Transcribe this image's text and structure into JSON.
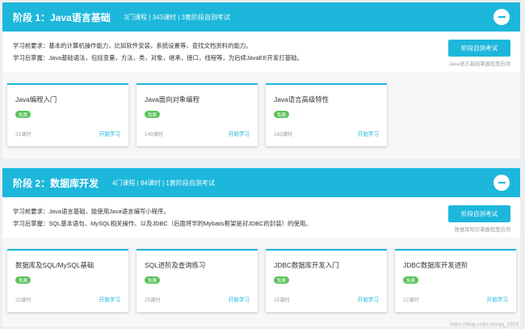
{
  "stages": [
    {
      "title": "阶段 1：Java语言基础",
      "meta": "3门课程 | 343课时 | 3套阶段自测考试",
      "requirement_before": "学习前要求：基本的计算机操作能力，比如软件安装，系统设置等，查找文档资料的能力。",
      "requirement_after": "学习后掌握：Java基础语法，包括变量，方法，类，对象，继承，接口，线程等，为后续JavaEE开发打基础。",
      "test_button": "阶段自测考试",
      "test_tip": "Java语言基础掌握程度自测",
      "courses": [
        {
          "name": "Java编程入门",
          "badge": "免费",
          "hours": "31课时",
          "action": "开始学习"
        },
        {
          "name": "Java面向对象编程",
          "badge": "免费",
          "hours": "149课时",
          "action": "开始学习"
        },
        {
          "name": "Java语言高级特性",
          "badge": "免费",
          "hours": "163课时",
          "action": "开始学习"
        }
      ]
    },
    {
      "title": "阶段 2：数据库开发",
      "meta": "4门课程 | 84课时 | 1套阶段自测考试",
      "requirement_before": "学习前要求：Java语言基础，能使用Java语言编写小程序。",
      "requirement_after": "学习后掌握：SQL基本语句、MySQL相关操作、以及JDBC（后面将学的Mybatis框架是对JDBC的封装）的使用。",
      "test_button": "阶段自测考试",
      "test_tip": "数据库知识掌握程度自测",
      "courses": [
        {
          "name": "数据库及SQL/MySQL基础",
          "badge": "免费",
          "hours": "22课时",
          "action": "开始学习"
        },
        {
          "name": "SQL进阶及查询练习",
          "badge": "免费",
          "hours": "25课时",
          "action": "开始学习"
        },
        {
          "name": "JDBC数据库开发入门",
          "badge": "免费",
          "hours": "15课时",
          "action": "开始学习"
        },
        {
          "name": "JDBC数据库开发进阶",
          "badge": "免费",
          "hours": "22课时",
          "action": "开始学习"
        }
      ]
    }
  ],
  "watermark": "https://blog.csdn.net/qq_1503"
}
